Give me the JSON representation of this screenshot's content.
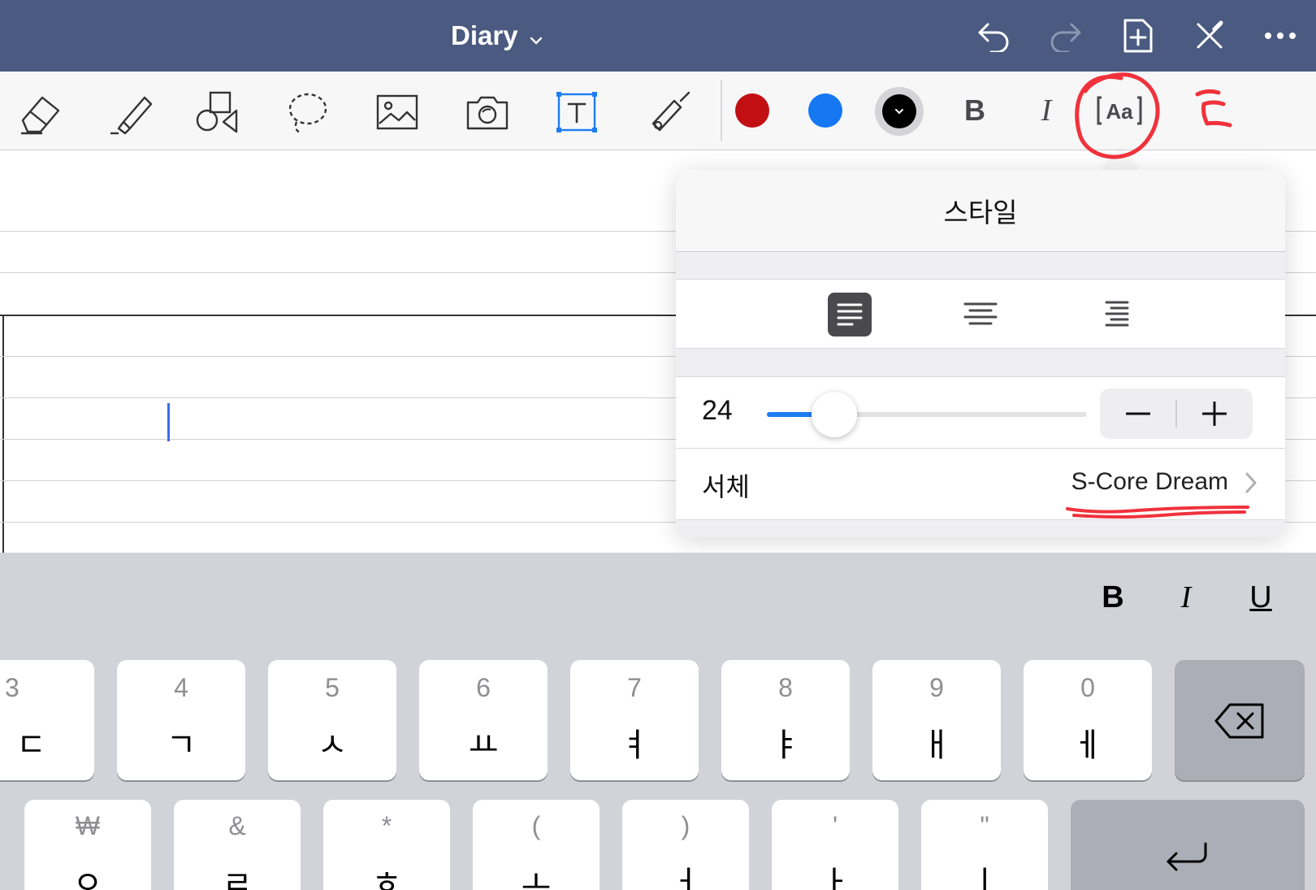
{
  "header": {
    "title": "Diary",
    "icons": [
      "undo-icon",
      "redo-icon",
      "add-page-icon",
      "close-tools-icon",
      "more-icon"
    ]
  },
  "toolbar": {
    "tools": [
      "eraser-icon",
      "highlighter-icon",
      "shapes-icon",
      "lasso-icon",
      "image-icon",
      "camera-icon",
      "text-box-icon",
      "laser-pointer-icon"
    ],
    "colors": [
      "#c20f14",
      "#1677f2",
      "#000000"
    ],
    "bold_label": "B",
    "italic_label": "I",
    "text_style_label": "Aa"
  },
  "style_popover": {
    "title": "스타일",
    "alignment": {
      "options": [
        "left",
        "center",
        "right"
      ],
      "selected": "left"
    },
    "size": {
      "value": "24",
      "slider_fraction": 0.16
    },
    "font": {
      "label": "서체",
      "value": "S-Core Dream"
    }
  },
  "keyboard": {
    "format": {
      "bold": "B",
      "italic": "I",
      "underline": "U"
    },
    "row1": [
      {
        "alt": "3",
        "main": "ㄷ"
      },
      {
        "alt": "4",
        "main": "ㄱ"
      },
      {
        "alt": "5",
        "main": "ㅅ"
      },
      {
        "alt": "6",
        "main": "ㅛ"
      },
      {
        "alt": "7",
        "main": "ㅕ"
      },
      {
        "alt": "8",
        "main": "ㅑ"
      },
      {
        "alt": "9",
        "main": "ㅐ"
      },
      {
        "alt": "0",
        "main": "ㅔ"
      }
    ],
    "row2": [
      {
        "alt": "₩",
        "main": "ㅇ"
      },
      {
        "alt": "&",
        "main": "ㄹ"
      },
      {
        "alt": "*",
        "main": "ㅎ"
      },
      {
        "alt": "(",
        "main": "ㅗ"
      },
      {
        "alt": ")",
        "main": "ㅓ"
      },
      {
        "alt": "'",
        "main": "ㅏ"
      },
      {
        "alt": "\"",
        "main": "ㅣ"
      }
    ]
  }
}
